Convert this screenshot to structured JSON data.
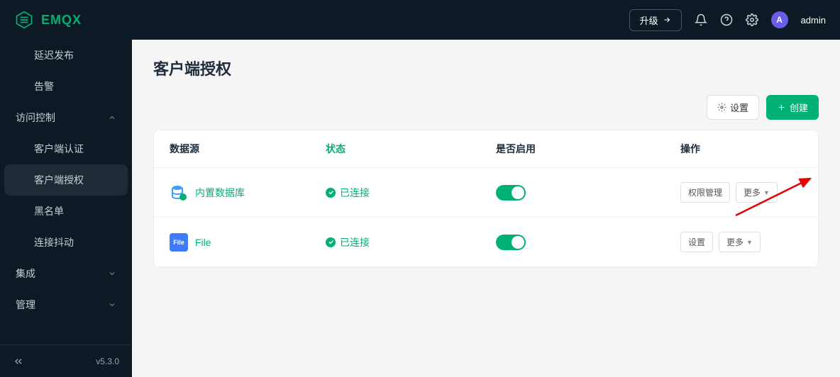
{
  "header": {
    "brand": "EMQX",
    "upgrade": "升级",
    "user_initial": "A",
    "username": "admin"
  },
  "sidebar": {
    "items": [
      {
        "label": "延迟发布",
        "type": "sub"
      },
      {
        "label": "告警",
        "type": "sub"
      },
      {
        "label": "访问控制",
        "type": "group",
        "expanded": true
      },
      {
        "label": "客户端认证",
        "type": "sub"
      },
      {
        "label": "客户端授权",
        "type": "sub",
        "active": true
      },
      {
        "label": "黑名单",
        "type": "sub"
      },
      {
        "label": "连接抖动",
        "type": "sub"
      },
      {
        "label": "集成",
        "type": "group",
        "expanded": false
      },
      {
        "label": "管理",
        "type": "group",
        "expanded": false
      }
    ],
    "version": "v5.3.0"
  },
  "page": {
    "title": "客户端授权",
    "settings_btn": "设置",
    "create_btn": "创建"
  },
  "table": {
    "headers": {
      "source": "数据源",
      "status": "状态",
      "enable": "是否启用",
      "ops": "操作"
    },
    "rows": [
      {
        "icon_type": "db",
        "name": "内置数据库",
        "status": "已连接",
        "enabled": true,
        "action1": "权限管理",
        "action2": "更多"
      },
      {
        "icon_type": "file",
        "icon_label": "File",
        "name": "File",
        "status": "已连接",
        "enabled": true,
        "action1": "设置",
        "action2": "更多"
      }
    ]
  }
}
